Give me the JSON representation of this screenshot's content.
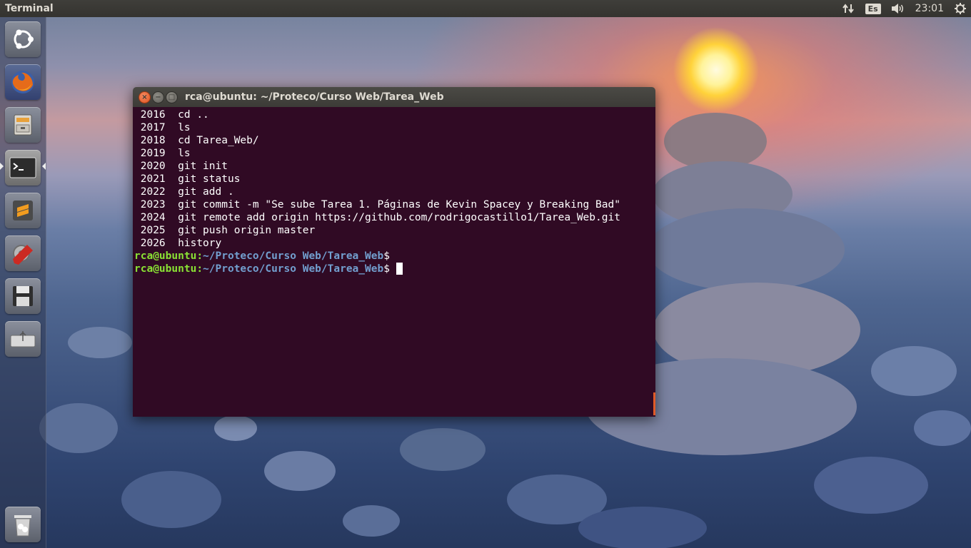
{
  "top_panel": {
    "app_title": "Terminal",
    "keyboard_layout": "Es",
    "clock": "23:01",
    "icons": [
      "network-transfer-icon",
      "keyboard-layout-indicator",
      "volume-icon",
      "session-gear-icon"
    ]
  },
  "launcher": {
    "items": [
      {
        "name": "ubuntu-dash",
        "icon": "ubuntu-logo-icon"
      },
      {
        "name": "firefox",
        "icon": "firefox-icon"
      },
      {
        "name": "files",
        "icon": "file-cabinet-icon"
      },
      {
        "name": "terminal",
        "icon": "terminal-icon",
        "active": true
      },
      {
        "name": "sublime-text",
        "icon": "sublime-text-icon"
      },
      {
        "name": "system-settings",
        "icon": "settings-wrench-icon"
      },
      {
        "name": "save-disk",
        "icon": "floppy-disk-icon"
      },
      {
        "name": "usb-drive",
        "icon": "usb-drive-icon"
      },
      {
        "name": "trash",
        "icon": "trash-icon"
      }
    ]
  },
  "terminal": {
    "title": "rca@ubuntu: ~/Proteco/Curso Web/Tarea_Web",
    "history": [
      {
        "num": "2016",
        "cmd": "cd .."
      },
      {
        "num": "2017",
        "cmd": "ls"
      },
      {
        "num": "2018",
        "cmd": "cd Tarea_Web/"
      },
      {
        "num": "2019",
        "cmd": "ls"
      },
      {
        "num": "2020",
        "cmd": "git init"
      },
      {
        "num": "2021",
        "cmd": "git status"
      },
      {
        "num": "2022",
        "cmd": "git add ."
      },
      {
        "num": "2023",
        "cmd": "git commit -m \"Se sube Tarea 1. Páginas de Kevin Spacey y Breaking Bad\""
      },
      {
        "num": "2024",
        "cmd": "git remote add origin https://github.com/rodrigocastillo1/Tarea_Web.git"
      },
      {
        "num": "2025",
        "cmd": "git push origin master"
      },
      {
        "num": "2026",
        "cmd": "history"
      }
    ],
    "prompts": [
      {
        "user": "rca@ubuntu",
        "sep": ":",
        "path": "~/Proteco/Curso Web/Tarea_Web",
        "symbol": "$"
      },
      {
        "user": "rca@ubuntu",
        "sep": ":",
        "path": "~/Proteco/Curso Web/Tarea_Web",
        "symbol": "$ "
      }
    ]
  },
  "colors": {
    "terminal_bg": "#300a24",
    "prompt_user": "#8ae234",
    "prompt_path": "#729fcf",
    "close_button": "#e0521f",
    "panel_bg": "#3c3b37"
  }
}
